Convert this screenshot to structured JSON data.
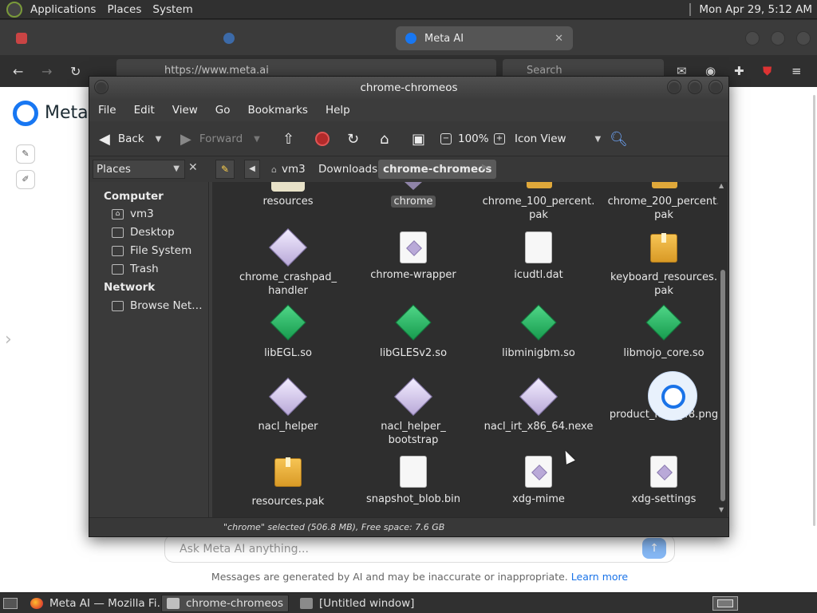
{
  "top_panel": {
    "menus": [
      "Applications",
      "Places",
      "System"
    ],
    "clock": "Mon Apr 29,  5:12 AM"
  },
  "firefox": {
    "tabs": [
      {
        "label": "",
        "color": "#c94444"
      },
      {
        "label": "",
        "color": "#3c6aa8"
      },
      {
        "label": "Meta AI",
        "color": "#1877f2",
        "close": "✕"
      }
    ],
    "url": "https://www.meta.ai",
    "search_placeholder": "Search"
  },
  "meta_page": {
    "wordmark": "Meta",
    "input_placeholder": "Ask Meta AI anything...",
    "disclaimer": "Messages are generated by AI and may be inaccurate or inappropriate.",
    "learn_more": "Learn more"
  },
  "file_manager": {
    "title": "chrome-chromeos",
    "menu": [
      "File",
      "Edit",
      "View",
      "Go",
      "Bookmarks",
      "Help"
    ],
    "toolbar": {
      "back": "Back",
      "forward": "Forward",
      "zoom": "100%",
      "view_mode": "Icon View"
    },
    "places_label": "Places",
    "breadcrumbs": [
      "vm3",
      "Downloads",
      "chrome-chromeos"
    ],
    "sidebar": {
      "computer_heading": "Computer",
      "computer_items": [
        "vm3",
        "Desktop",
        "File System",
        "Trash"
      ],
      "network_heading": "Network",
      "network_items": [
        "Browse Net…"
      ]
    },
    "top_row_partial": [
      {
        "name": "resources",
        "kind": "folder"
      },
      {
        "name": "chrome",
        "kind": "exe",
        "selected": true
      },
      {
        "name": "chrome_100_percent.\npak",
        "kind": "pak"
      },
      {
        "name": "chrome_200_percent.\npak",
        "kind": "pak"
      }
    ],
    "files": [
      {
        "name": "chrome_crashpad_\nhandler",
        "kind": "exe"
      },
      {
        "name": "chrome-wrapper",
        "kind": "script"
      },
      {
        "name": "icudtl.dat",
        "kind": "doc"
      },
      {
        "name": "keyboard_resources.\npak",
        "kind": "pak"
      },
      {
        "name": "libEGL.so",
        "kind": "so"
      },
      {
        "name": "libGLESv2.so",
        "kind": "so"
      },
      {
        "name": "libminigbm.so",
        "kind": "so"
      },
      {
        "name": "libmojo_core.so",
        "kind": "so"
      },
      {
        "name": "nacl_helper",
        "kind": "exe"
      },
      {
        "name": "nacl_helper_\nbootstrap",
        "kind": "exe"
      },
      {
        "name": "nacl_irt_x86_64.nexe",
        "kind": "exe"
      },
      {
        "name": "product_logo_48.png",
        "kind": "png"
      },
      {
        "name": "resources.pak",
        "kind": "pak"
      },
      {
        "name": "snapshot_blob.bin",
        "kind": "doc"
      },
      {
        "name": "xdg-mime",
        "kind": "script"
      },
      {
        "name": "xdg-settings",
        "kind": "script"
      }
    ],
    "status": "\"chrome\" selected (506.8 MB), Free space: 7.6 GB"
  },
  "taskbar": {
    "tasks": [
      {
        "label": "Meta AI — Mozilla Fi…",
        "icon": "firefox-icon"
      },
      {
        "label": "chrome-chromeos",
        "icon": "folder-icon",
        "active": true
      },
      {
        "label": "[Untitled window]",
        "icon": "window-icon"
      }
    ]
  }
}
